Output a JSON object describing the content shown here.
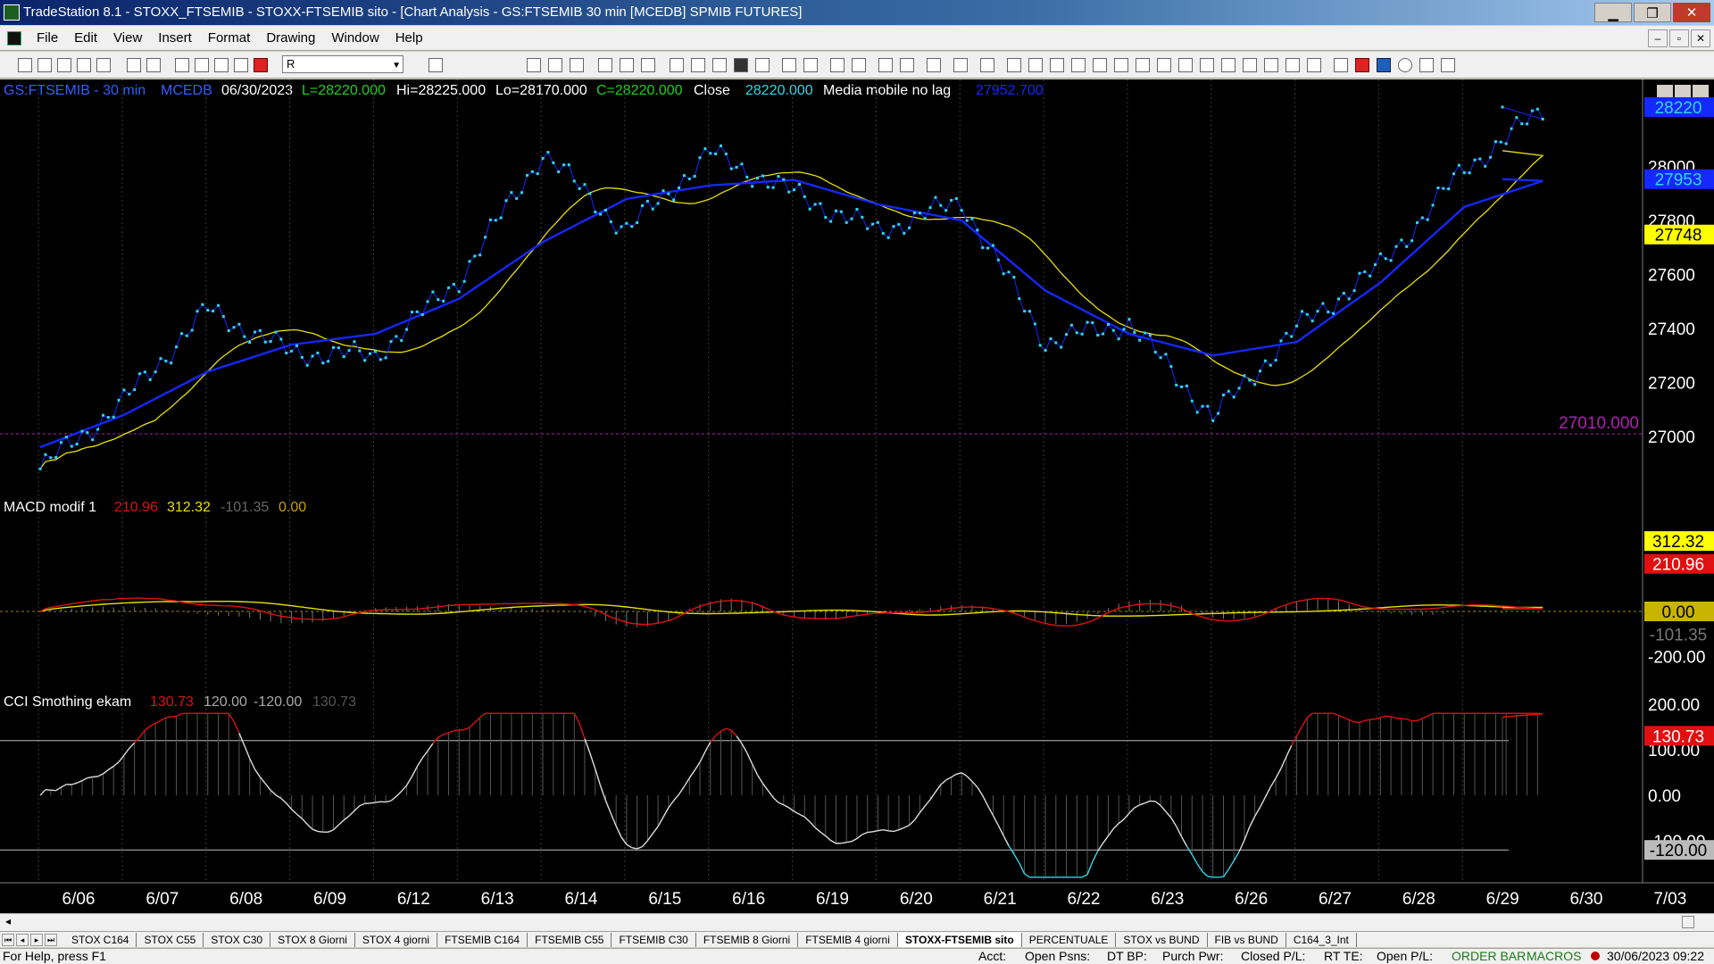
{
  "window": {
    "title": "TradeStation 8.1 - STOXX_FTSEMIB - STOXX-FTSEMIB sito - [Chart Analysis - GS:FTSEMIB  30 min  [MCEDB] SPMIB FUTURES]",
    "minimize": "▁",
    "maximize": "❐",
    "close": "✕"
  },
  "menu": {
    "items": [
      "File",
      "Edit",
      "View",
      "Insert",
      "Format",
      "Drawing",
      "Window",
      "Help"
    ],
    "mdi_controls": [
      "–",
      "▫",
      "✕"
    ]
  },
  "toolbar": {
    "symbol_value": "R",
    "symbol_dropdown": "▼"
  },
  "chart": {
    "header": {
      "symbol": "GS:FTSEMIB - 30 min",
      "feed": "MCEDB",
      "date": "06/30/2023",
      "low_label": "L=28220.000",
      "hi": "Hi=28225.000",
      "lo": "Lo=28170.000",
      "close_c": "C=28220.000",
      "close_word": "Close",
      "close_value": "28220.000",
      "indicator": "Media mobile no lag",
      "indicator_value": "27952.700"
    },
    "price_axis": {
      "ticks": [
        "28000",
        "27800",
        "27600",
        "27400",
        "27200",
        "27000"
      ],
      "tick_values": [
        28000,
        27800,
        27600,
        27400,
        27200,
        27000
      ],
      "last_price_tag": "28220",
      "blue_ma_tag": "27953",
      "yellow_ma_tag": "27748",
      "hline_label": "27010.000"
    },
    "macd": {
      "name": "MACD modif 1",
      "v1": "210.96",
      "v2": "312.32",
      "v3": "-101.35",
      "v4": "0.00",
      "axis_tags": [
        "312.32",
        "210.96",
        "0.00",
        "-101.35",
        "-200.00"
      ]
    },
    "cci": {
      "name": "CCI Smothing ekam",
      "v1": "130.73",
      "v2": "120.00",
      "v3": "-120.00",
      "v4": "130.73",
      "axis_tags": [
        "200.00",
        "130.73",
        "100.00",
        "0.00",
        "-100.00",
        "-120.00"
      ]
    },
    "date_labels": [
      "6/06",
      "6/07",
      "6/08",
      "6/09",
      "6/12",
      "6/13",
      "6/14",
      "6/15",
      "6/16",
      "6/19",
      "6/20",
      "6/21",
      "6/22",
      "6/23",
      "6/26",
      "6/27",
      "6/28",
      "6/29",
      "6/30",
      "7/03"
    ],
    "colors": {
      "price": "#33d6e8",
      "ma_blue": "#1428ff",
      "ma_yellow": "#e8e000",
      "macd_red": "#e01010",
      "macd_yellow": "#e8e000",
      "hline": "#b020b0",
      "header_green": "#20d020",
      "header_blue": "#3060ff"
    }
  },
  "chart_data": {
    "type": "line",
    "title": "GS:FTSEMIB - 30 min",
    "xlabel": "",
    "ylabel": "",
    "x": [
      "6/06",
      "6/07",
      "6/08",
      "6/09",
      "6/12",
      "6/13",
      "6/14",
      "6/15",
      "6/16",
      "6/19",
      "6/20",
      "6/21",
      "6/22",
      "6/23",
      "6/26",
      "6/27",
      "6/28",
      "6/29"
    ],
    "ylim": [
      26900,
      28300
    ],
    "series": [
      {
        "name": "Close",
        "values": [
          26880,
          27130,
          27470,
          27310,
          27300,
          27580,
          28050,
          27760,
          28050,
          27900,
          27760,
          27870,
          27350,
          27420,
          27070,
          27400,
          27630,
          27990
        ]
      },
      {
        "name": "Media mobile no lag",
        "values": [
          26960,
          27080,
          27240,
          27340,
          27380,
          27510,
          27720,
          27880,
          27930,
          27950,
          27860,
          27800,
          27540,
          27380,
          27300,
          27350,
          27570,
          27850
        ]
      }
    ],
    "last_close": 28220,
    "hline": 27010
  },
  "tabs": [
    "STOX C164",
    "STOX C55",
    "STOX  C30",
    "STOX  8 Giorni",
    "STOX 4 giorni",
    "FTSEMIB C164",
    "FTSEMIB C55",
    "FTSEMIB C30",
    "FTSEMIB  8 Giorni",
    "FTSEMIB  4 giorni",
    "STOXX-FTSEMIB sito",
    "PERCENTUALE",
    "STOX vs BUND",
    "FIB vs BUND",
    "C164_3_Int"
  ],
  "status": {
    "help": "For Help, press F1",
    "acct": "Acct:",
    "open_psns": "Open Psns:",
    "dt_bp": "DT BP:",
    "purch_pwr": "Purch Pwr:",
    "closed_pl": "Closed P/L:",
    "rt_te": "RT TE:",
    "open_pl": "Open P/L:",
    "order_bar": "ORDER BAR",
    "macros": "MACROS",
    "datetime": "30/06/2023 09:22"
  }
}
